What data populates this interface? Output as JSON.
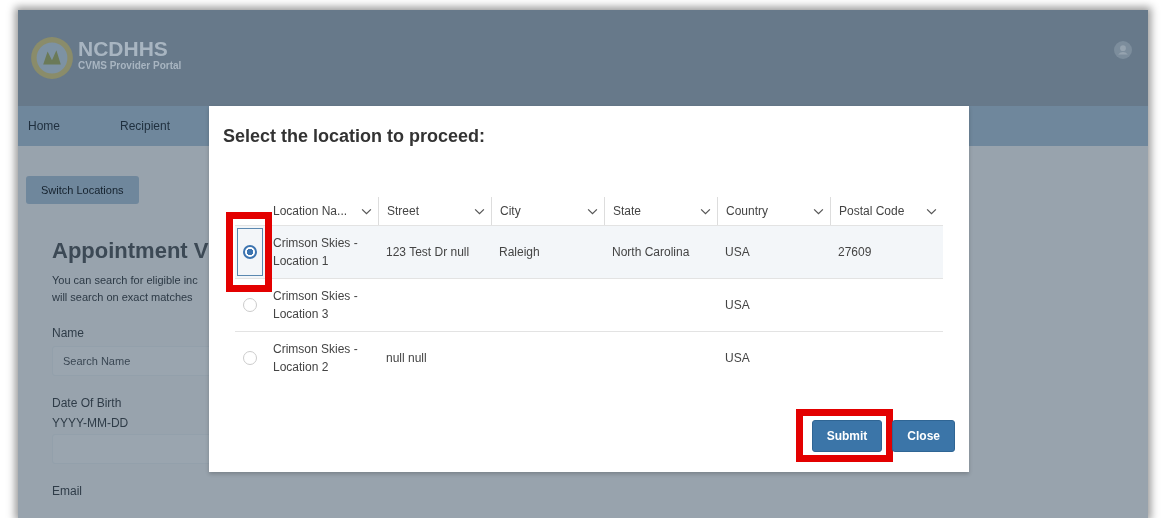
{
  "header": {
    "brand": "NCDHHS",
    "subtitle": "CVMS Provider Portal"
  },
  "nav": [
    "Home",
    "Recipient"
  ],
  "switch_button": "Switch Locations",
  "page": {
    "title": "Appointment V",
    "intro": [
      "You can search for eligible inc",
      "will search on exact matches"
    ],
    "fields": [
      {
        "label": "Name",
        "placeholder": "Search Name"
      },
      {
        "label": "Date Of Birth",
        "hint": "YYYY-MM-DD"
      },
      {
        "label": "Email"
      }
    ]
  },
  "dialog": {
    "title": "Select the location to proceed:",
    "columns": [
      "Location Na...",
      "Street",
      "City",
      "State",
      "Country",
      "Postal Code"
    ],
    "rows": [
      {
        "selected": true,
        "highlighted": true,
        "cells": [
          "Crimson Skies - Location 1",
          "123 Test Dr null",
          "Raleigh",
          "North Carolina",
          "USA",
          "27609"
        ]
      },
      {
        "selected": false,
        "highlighted": false,
        "cells": [
          "Crimson Skies - Location 3",
          "",
          "",
          "",
          "USA",
          ""
        ]
      },
      {
        "selected": false,
        "highlighted": false,
        "cells": [
          "Crimson Skies - Location 2",
          "null null",
          "",
          "",
          "USA",
          ""
        ]
      }
    ],
    "buttons": [
      {
        "label": "Submit",
        "highlighted": true
      },
      {
        "label": "Close",
        "highlighted": false
      }
    ]
  }
}
